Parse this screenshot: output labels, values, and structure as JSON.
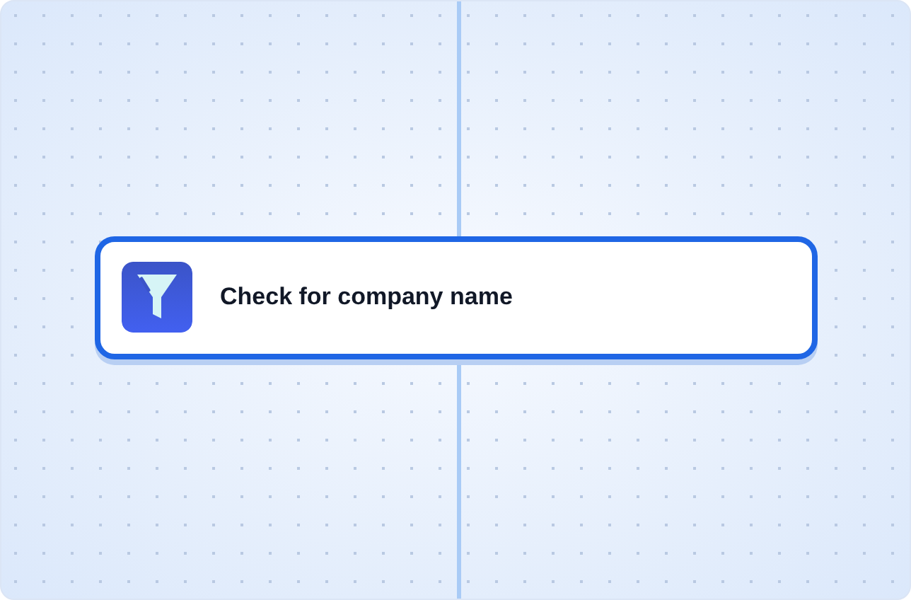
{
  "node": {
    "title": "Check for company name",
    "selected": true
  }
}
